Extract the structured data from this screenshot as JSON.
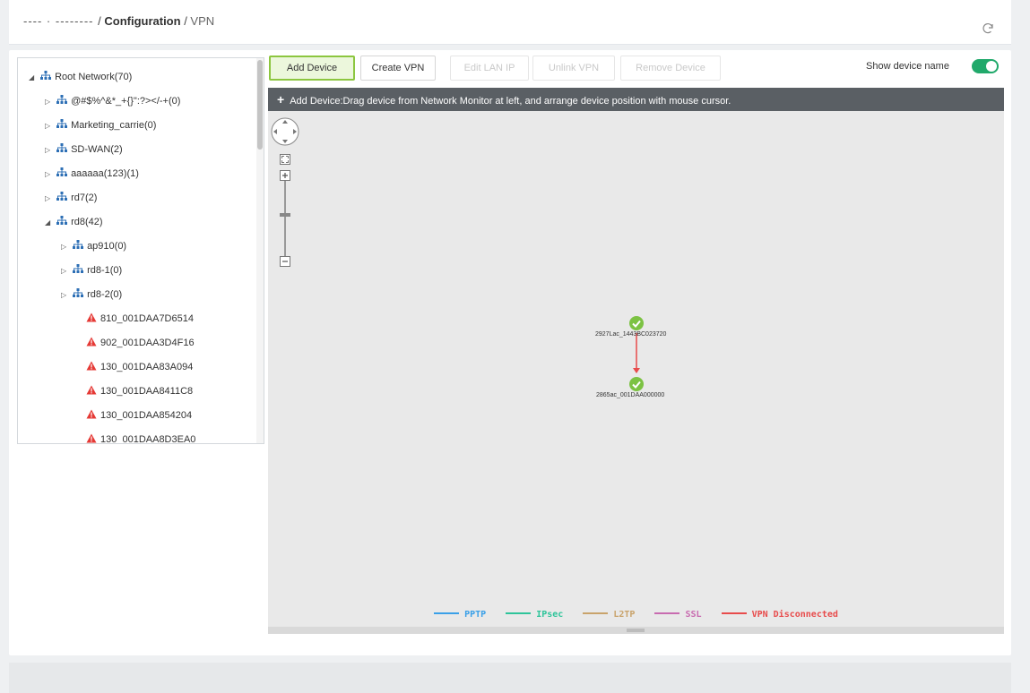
{
  "breadcrumb": {
    "prefix": "----  ·  -------- ",
    "sep1": " / ",
    "current_section": "Configuration",
    "sep2": " / ",
    "page": "VPN"
  },
  "icons": {
    "refresh": "refresh-icon",
    "network": "network-icon",
    "warning": "warning-icon",
    "device_ok": "check-circle-icon"
  },
  "tree": [
    {
      "label": "Root Network(70)",
      "expander": "◢",
      "icon": "network"
    },
    {
      "label": "@#$%^&*_+{}\":?></-+(0)",
      "expander": "▷",
      "icon": "network"
    },
    {
      "label": "Marketing_carrie(0)",
      "expander": "▷",
      "icon": "network"
    },
    {
      "label": "SD-WAN(2)",
      "expander": "▷",
      "icon": "network"
    },
    {
      "label": "aaaaaa(123)(1)",
      "expander": "▷",
      "icon": "network"
    },
    {
      "label": "rd7(2)",
      "expander": "▷",
      "icon": "network"
    },
    {
      "label": "rd8(42)",
      "expander": "◢",
      "icon": "network"
    },
    {
      "label": "ap910(0)",
      "expander": "▷",
      "icon": "network"
    },
    {
      "label": "rd8-1(0)",
      "expander": "▷",
      "icon": "network"
    },
    {
      "label": "rd8-2(0)",
      "expander": "▷",
      "icon": "network"
    },
    {
      "label": "810_001DAA7D6514",
      "expander": "",
      "icon": "warning"
    },
    {
      "label": "902_001DAA3D4F16",
      "expander": "",
      "icon": "warning"
    },
    {
      "label": "130_001DAA83A094",
      "expander": "",
      "icon": "warning"
    },
    {
      "label": "130_001DAA8411C8",
      "expander": "",
      "icon": "warning"
    },
    {
      "label": "130_001DAA854204",
      "expander": "",
      "icon": "warning"
    },
    {
      "label": "130_001DAA8D3EA0",
      "expander": "",
      "icon": "warning"
    }
  ],
  "toolbar": {
    "add_device": "Add Device",
    "create_vpn": "Create VPN",
    "edit_lan_ip": "Edit LAN IP",
    "unlink_vpn": "Unlink VPN",
    "remove_device": "Remove Device",
    "show_device_name": "Show device name",
    "show_device_name_on": true
  },
  "info_bar": {
    "text": "Add Device:Drag device from Network Monitor at left, and arrange device position with mouse cursor."
  },
  "topology": {
    "devices": [
      {
        "label": "2927Lac_1443BC023720",
        "status": "ok"
      },
      {
        "label": "2865ac_001DAA000000",
        "status": "ok"
      }
    ],
    "link_type": "VPN Disconnected"
  },
  "legend": [
    {
      "label": "PPTP",
      "color": "#3aa0e8"
    },
    {
      "label": "IPsec",
      "color": "#2ec49a"
    },
    {
      "label": "L2TP",
      "color": "#c9a36b"
    },
    {
      "label": "SSL",
      "color": "#c86bb0"
    },
    {
      "label": "VPN Disconnected",
      "color": "#e84b4b"
    }
  ],
  "colors": {
    "accent_green": "#8cc63f",
    "toggle_on": "#21a96b",
    "warning_red": "#e53935",
    "network_blue": "#2d6fb5",
    "device_ok": "#7cc243"
  }
}
